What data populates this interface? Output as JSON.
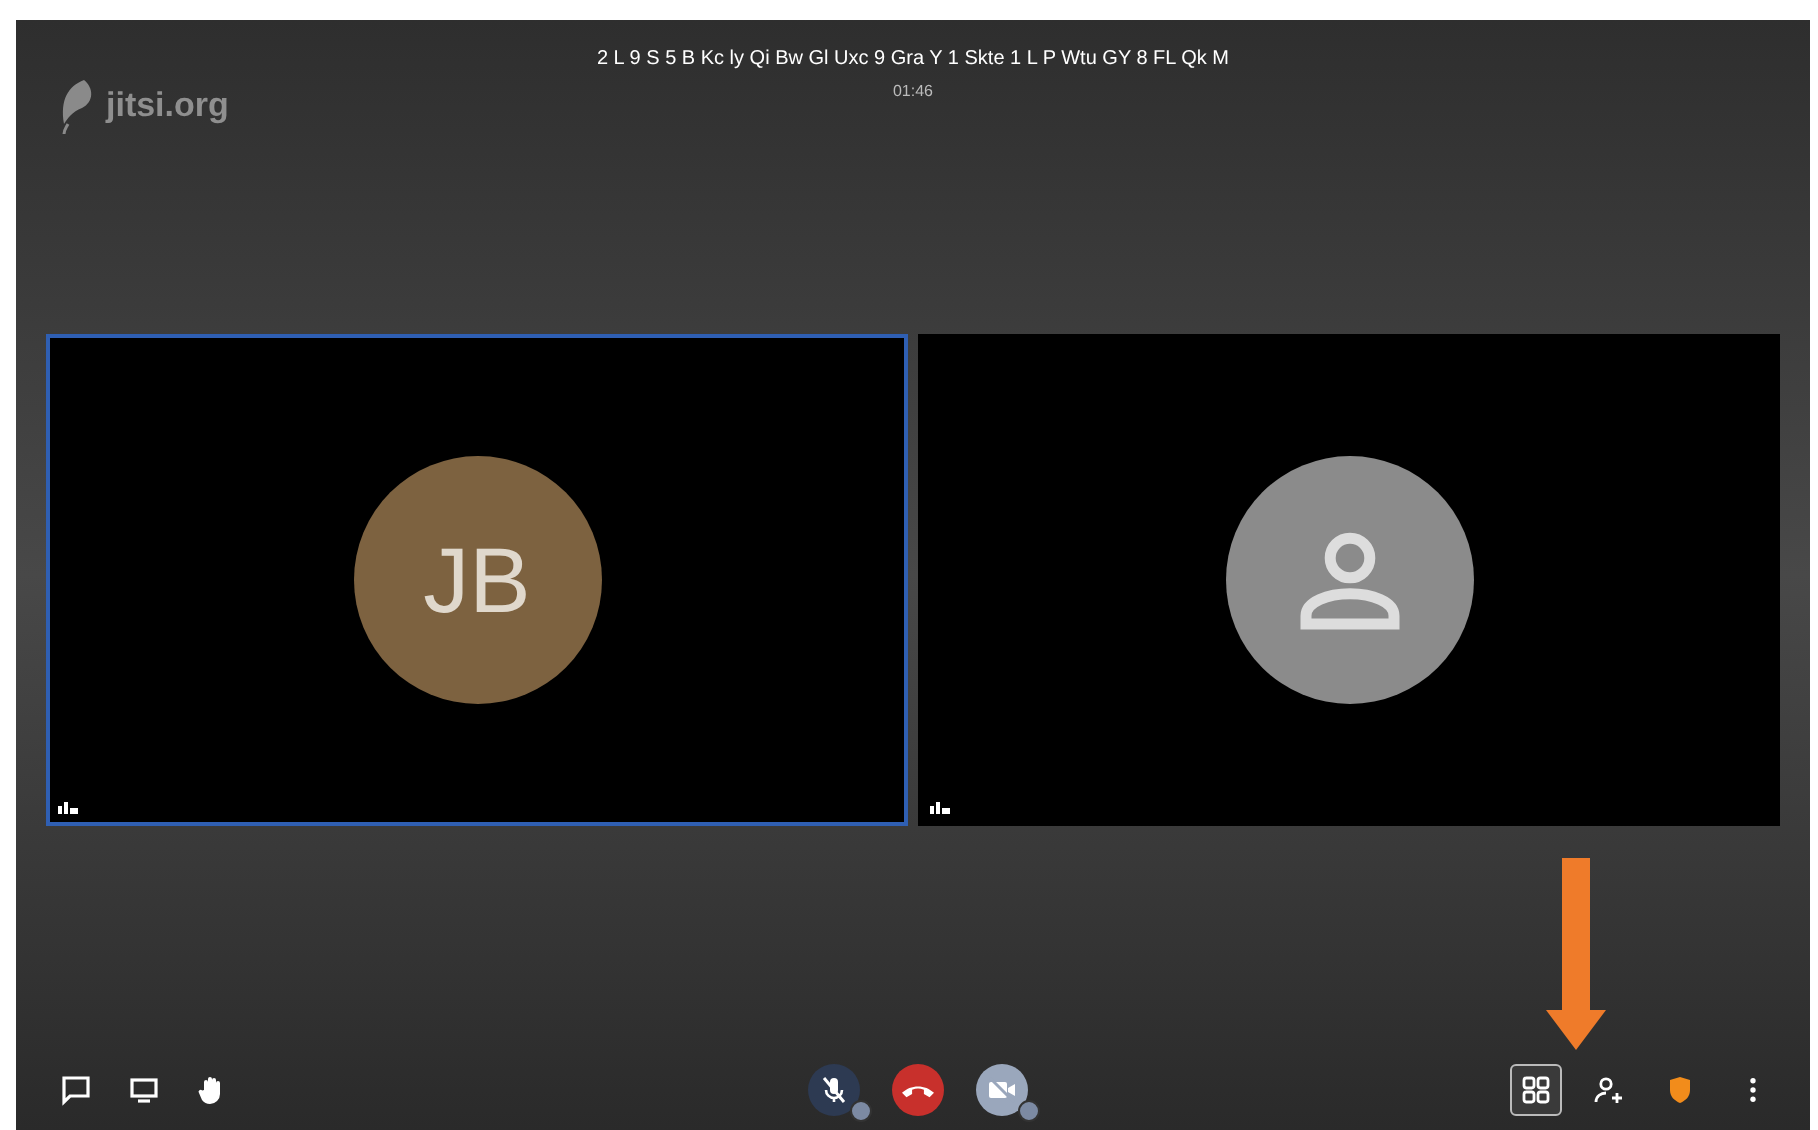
{
  "logo": {
    "text": "jitsi.org"
  },
  "header": {
    "title": "2 L 9 S 5 B Kc ly Qi Bw Gl Uxc 9 Gra Y 1 Skte 1 L P Wtu GY 8 FL Qk M",
    "timer": "01:46"
  },
  "tiles": [
    {
      "kind": "initials",
      "initials": "JB",
      "color": "#7d6240",
      "selected": true
    },
    {
      "kind": "silhouette",
      "selected": false
    }
  ],
  "toolbar": {
    "left": [
      {
        "kind": "chat"
      },
      {
        "kind": "screen"
      },
      {
        "kind": "hand"
      }
    ],
    "center": [
      {
        "kind": "mic",
        "muted": true
      },
      {
        "kind": "hangup"
      },
      {
        "kind": "camera",
        "muted": true
      }
    ],
    "right": [
      {
        "kind": "tileview",
        "selected": true
      },
      {
        "kind": "invite",
        "selected": false
      },
      {
        "kind": "security",
        "selected": false
      },
      {
        "kind": "more",
        "selected": false
      }
    ]
  }
}
